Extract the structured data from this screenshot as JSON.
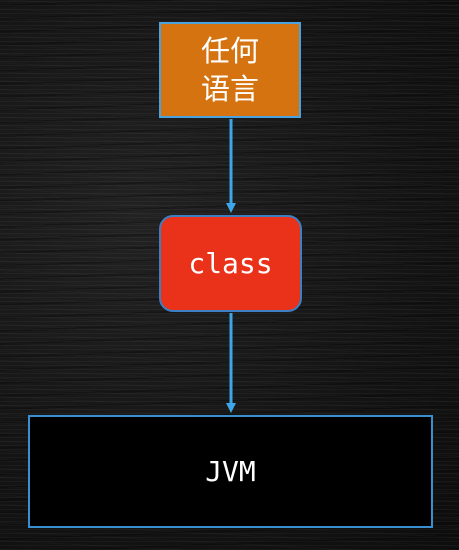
{
  "diagram": {
    "nodes": {
      "language": {
        "line1": "任何",
        "line2": "语言",
        "fill": "#d4730f",
        "border": "#4aa3df"
      },
      "class": {
        "label": "class",
        "fill": "#ea3119",
        "border": "#3e7fc4"
      },
      "jvm": {
        "label": "JVM",
        "fill": "#000000",
        "border": "#3a8fd0"
      }
    },
    "edges": [
      {
        "from": "language",
        "to": "class"
      },
      {
        "from": "class",
        "to": "jvm"
      }
    ],
    "arrow_color": "#3ea6e8"
  }
}
